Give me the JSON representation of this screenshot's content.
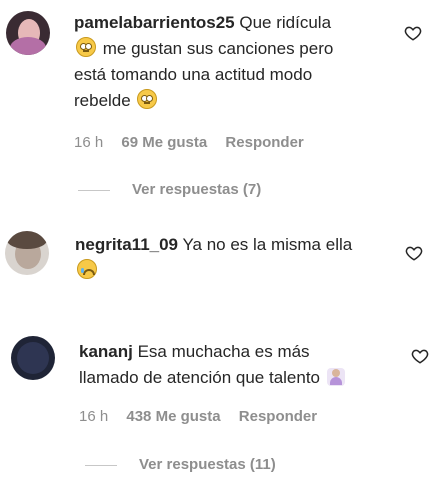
{
  "comments": [
    {
      "username": "pamelabarrientos25",
      "text_1": "Que ridícula",
      "text_2": "me gustan sus canciones pero",
      "text_3": "está tomando una actitud modo",
      "text_4": "rebelde",
      "time": "16 h",
      "likes": "69 Me gusta",
      "reply": "Responder",
      "view_replies": "Ver respuestas (7)",
      "emojis": [
        "face-with-rolling-eyes",
        "face-with-rolling-eyes"
      ]
    },
    {
      "username": "negrita11_09",
      "text_1": "Ya no es la misma ella",
      "emojis": [
        "crying-face"
      ]
    },
    {
      "username": "kananj",
      "text_1": "Esa muchacha es más",
      "text_2": "llamado de atención que talento",
      "time": "16 h",
      "likes": "438 Me gusta",
      "reply": "Responder",
      "view_replies": "Ver respuestas (11)",
      "emojis": [
        "person-facepalming"
      ]
    }
  ],
  "icons": {
    "like": "heart-outline-icon"
  },
  "colors": {
    "text": "#262626",
    "secondary": "#8e8e8e"
  }
}
